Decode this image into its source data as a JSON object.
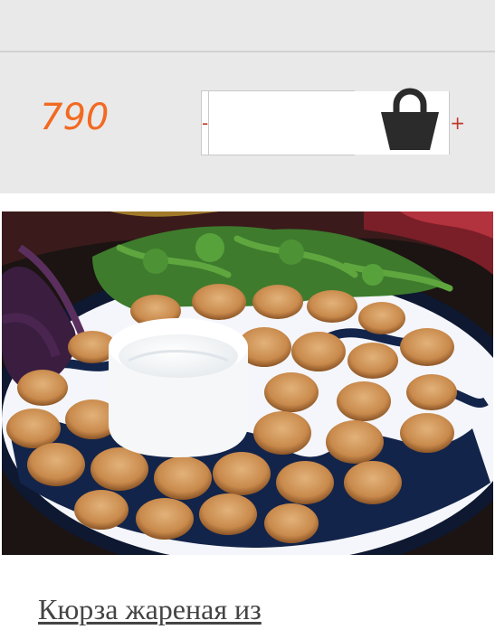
{
  "product": {
    "price": "790",
    "quantity": {
      "minus_label": "-",
      "plus_label": "+",
      "value": ""
    },
    "cart_icon": "shopping-basket-icon",
    "image_description_icon": "fried-dumplings-photo",
    "name_visible": "Кюрза жареная из"
  },
  "colors": {
    "price": "#f26a21",
    "stepper_sign": "#c0392b",
    "bar_background": "#e9e9e9",
    "cart_icon": "#2b2b2b"
  }
}
